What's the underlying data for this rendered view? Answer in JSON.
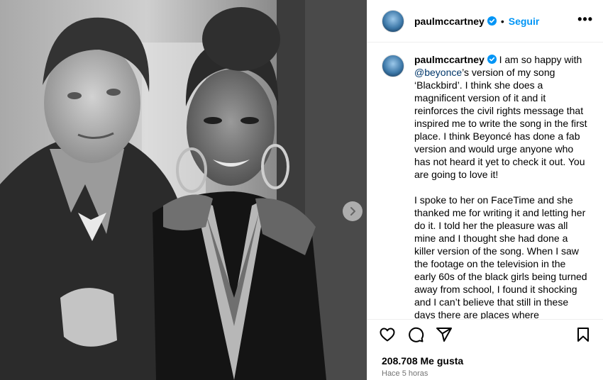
{
  "post": {
    "username": "paulmccartney",
    "follow_label": "Seguir",
    "separator": "•",
    "more_label": "•••",
    "caption_mention": "@beyonce",
    "caption_part1": "I am so happy with ",
    "caption_part2": "’s version of my song ‘Blackbird’. I think she does a magnificent version of it and it reinforces the civil rights message that inspired me to write the song in the first place. I think Beyoncé has done a fab version and would urge anyone who has not heard it yet to check it out. You are going to love it!\n\nI spoke to her on FaceTime and she thanked me for writing it and letting her do it. I told her the pleasure was all mine and I thought she had done a killer version of the song. When I saw the footage on the television in the early 60s of the black girls being turned away from school, I found it shocking and I can’t believe that still in these days there are places where",
    "likes": "208.708 Me gusta",
    "timestamp": "Hace 5 horas"
  },
  "icons": {
    "verified": "verified-badge-icon",
    "like": "heart-icon",
    "comment": "comment-icon",
    "share": "share-icon",
    "save": "bookmark-icon",
    "next": "chevron-right-icon"
  },
  "colors": {
    "link": "#0095f6",
    "mention": "#00376b",
    "muted": "#737373"
  }
}
